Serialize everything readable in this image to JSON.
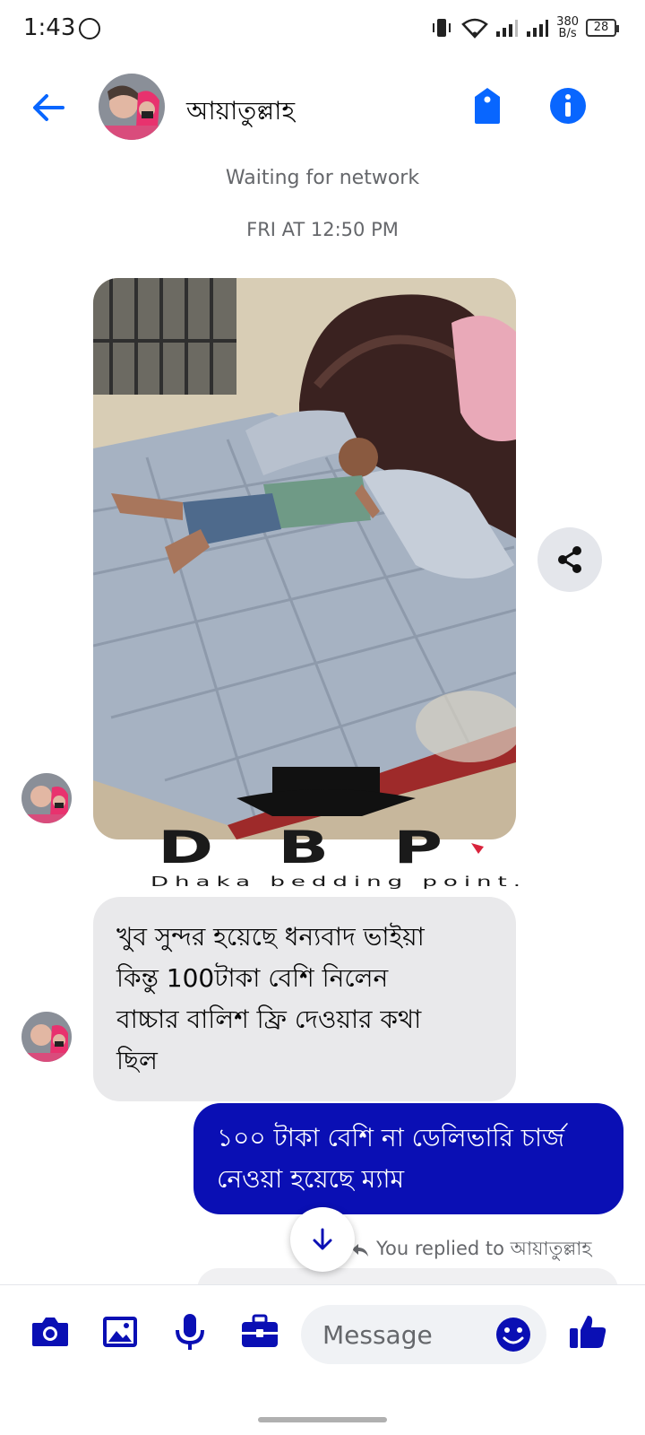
{
  "status_bar": {
    "time": "1:43",
    "net_speed_value": "380",
    "net_speed_unit": "B/s",
    "battery": "28"
  },
  "header": {
    "contact_name": "আয়াতুল্লাহ",
    "back_icon": "arrow-left-icon",
    "tag_icon": "tag-icon",
    "info_icon": "info-icon"
  },
  "conversation": {
    "network_status": "Waiting for network",
    "timestamp": "FRI AT 12:50 PM",
    "watermark": {
      "logo": "DBP",
      "tagline": "Dhaka bedding point."
    },
    "incoming_message": {
      "lines": [
        "খুব সুন্দর হয়েছে ধন্যবাদ ভাইয়া",
        "কিন্তু 100টাকা বেশি নিলেন",
        "বাচ্চার বালিশ ফ্রি দেওয়ার কথা",
        "ছিল"
      ]
    },
    "outgoing_message": {
      "lines": [
        "১০০ টাকা বেশি না ডেলিভারি চার্জ",
        "নেওয়া হয়েছে ম্যাম"
      ]
    },
    "reply_note": "You replied to আয়াতুল্লাহ"
  },
  "composer": {
    "placeholder": "Message",
    "icons": [
      "camera-icon",
      "image-icon",
      "microphone-icon",
      "briefcase-icon",
      "emoji-icon",
      "thumbs-up-icon"
    ]
  },
  "colors": {
    "accent": "#0a0fb4",
    "messenger_blue": "#0866ff",
    "incoming_bubble": "#e9e9eb"
  }
}
